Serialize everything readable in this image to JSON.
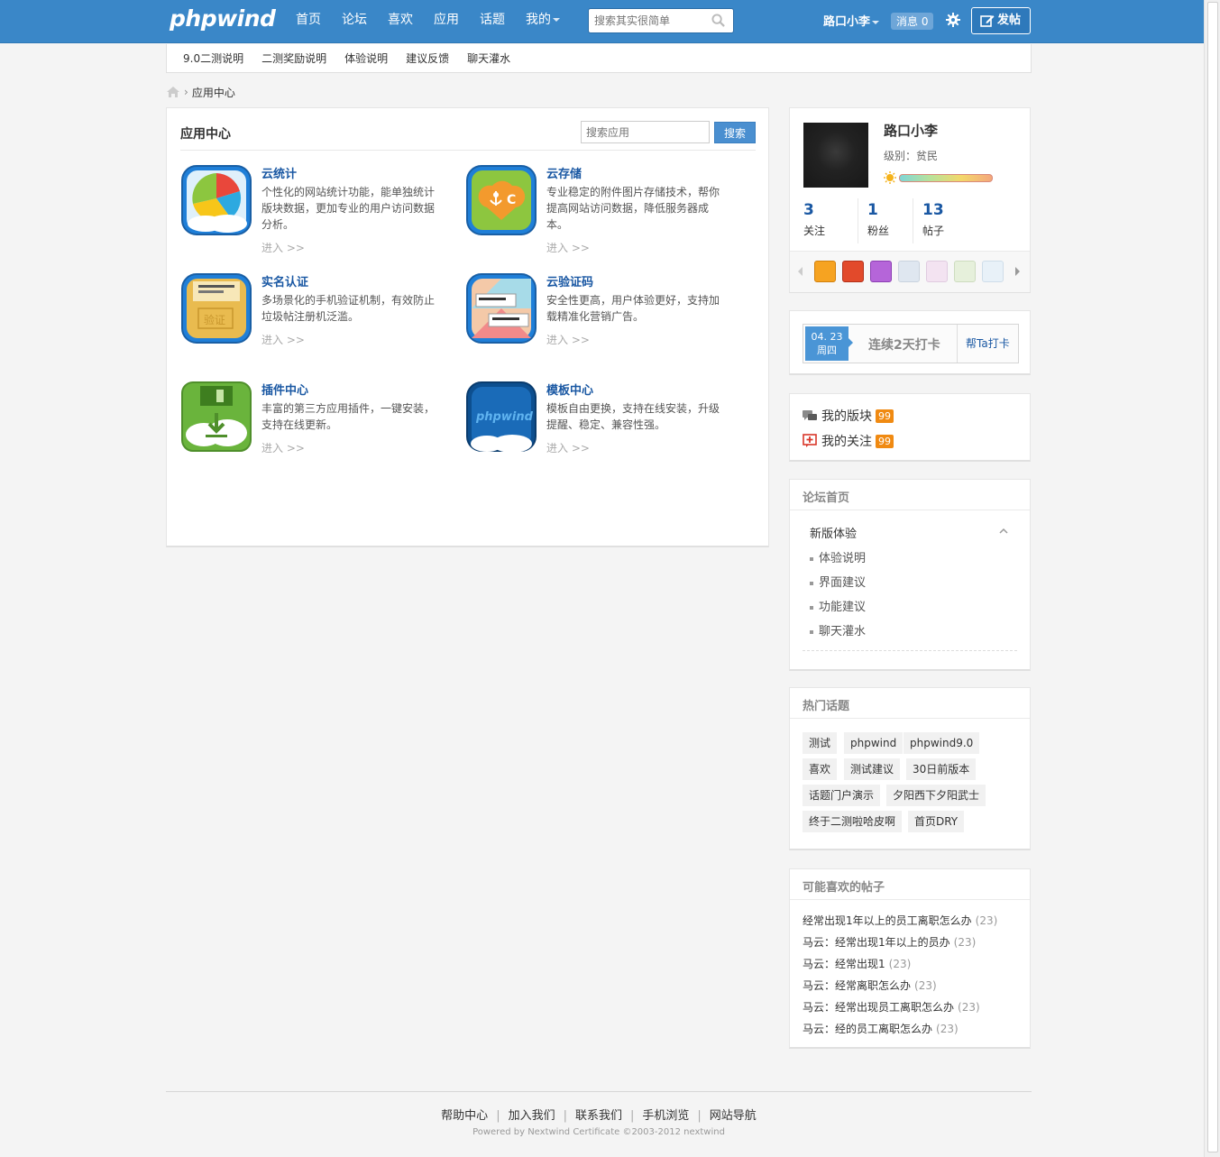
{
  "header": {
    "logo": "phpwind",
    "nav": [
      "首页",
      "论坛",
      "喜欢",
      "应用",
      "话题",
      "我的"
    ],
    "search_placeholder": "搜索其实很简单",
    "username": "路口小李",
    "messages": "消息 0",
    "post_label": "发帖",
    "accent": "#3a87c8"
  },
  "subnav": [
    "9.0二测说明",
    "二测奖励说明",
    "体验说明",
    "建议反馈",
    "聊天灌水"
  ],
  "breadcrumb": {
    "current": "应用中心"
  },
  "app_center": {
    "title": "应用中心",
    "search_placeholder": "搜索应用",
    "search_button": "搜索",
    "enter_label": "进入",
    "apps": [
      {
        "name": "云统计",
        "desc": "个性化的网站统计功能，能单独统计版块数据，更加专业的用户访问数据分析。",
        "icon": "pie-chart-icon"
      },
      {
        "name": "云存储",
        "desc": "专业稳定的附件图片存储技术，帮你提高网站访问数据，降低服务器成本。",
        "icon": "cloud-storage-icon"
      },
      {
        "name": "实名认证",
        "desc": "多场景化的手机验证机制，有效防止垃圾帖注册机泛滥。",
        "icon": "id-card-icon"
      },
      {
        "name": "云验证码",
        "desc": "安全性更高，用户体验更好，支持加载精准化营销广告。",
        "icon": "captcha-icon"
      },
      {
        "name": "插件中心",
        "desc": "丰富的第三方应用插件，一键安装，支持在线更新。",
        "icon": "download-icon"
      },
      {
        "name": "模板中心",
        "desc": "模板自由更换，支持在线安装，升级提醒、稳定、兼容性强。",
        "icon": "template-icon"
      }
    ]
  },
  "profile": {
    "name": "路口小李",
    "level": "级别：贫民",
    "stats": [
      {
        "num": "3",
        "label": "关注"
      },
      {
        "num": "1",
        "label": "粉丝"
      },
      {
        "num": "13",
        "label": "帖子"
      }
    ]
  },
  "checkin": {
    "date": "04. 23",
    "weekday": "周四",
    "streak": "连续2天打卡",
    "help": "帮Ta打卡"
  },
  "my": [
    {
      "label": "我的版块",
      "count": "99"
    },
    {
      "label": "我的关注",
      "count": "99"
    }
  ],
  "forum": {
    "title": "论坛首页",
    "group": "新版体验",
    "items": [
      "体验说明",
      "界面建议",
      "功能建议",
      "聊天灌水"
    ]
  },
  "topics": {
    "title": "热门话题",
    "tags": [
      "测试",
      "phpwind",
      "phpwind9.0",
      "喜欢",
      "测试建议",
      "30日前版本",
      "话题门户演示",
      "夕阳西下夕阳武士",
      "终于二测啦哈皮啊",
      "首页DRY"
    ]
  },
  "likes": {
    "title": "可能喜欢的帖子",
    "items": [
      {
        "title": "经常出现1年以上的员工离职怎么办",
        "count": "(23)"
      },
      {
        "title": "马云：经常出现1年以上的员办",
        "count": "(23)"
      },
      {
        "title": "马云：经常出现1",
        "count": "(23)"
      },
      {
        "title": "马云：经常离职怎么办",
        "count": "(23)"
      },
      {
        "title": "马云：经常出现员工离职怎么办",
        "count": "(23)"
      },
      {
        "title": "马云：经的员工离职怎么办",
        "count": "(23)"
      }
    ]
  },
  "footer": {
    "links": [
      "帮助中心",
      "加入我们",
      "联系我们",
      "手机浏览",
      "网站导航"
    ],
    "copyright": "Powered by Nextwind Certificate ©2003-2012 nextwind"
  }
}
